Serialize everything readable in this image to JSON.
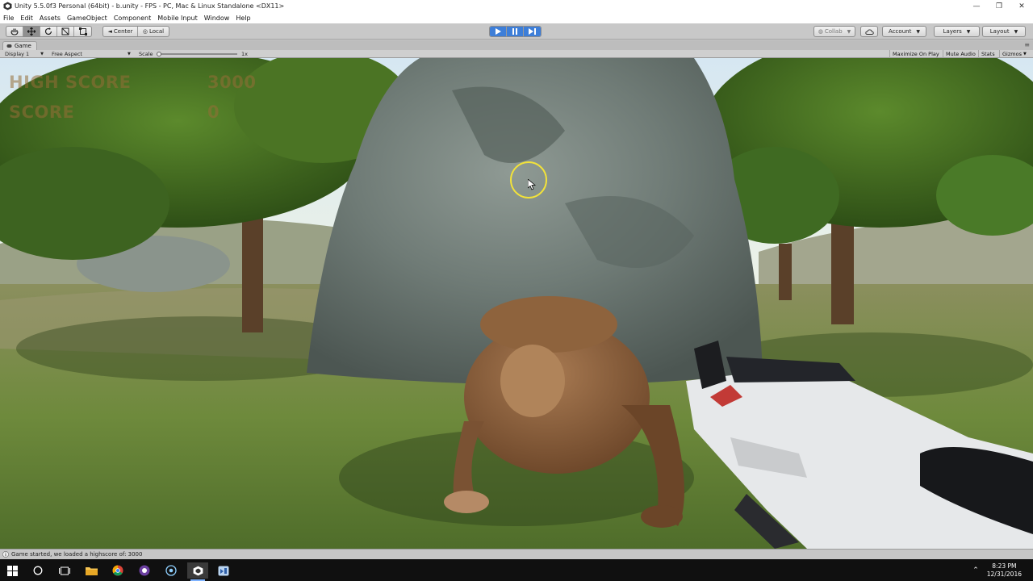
{
  "window": {
    "title": "Unity 5.5.0f3 Personal (64bit) - b.unity - FPS - PC, Mac & Linux Standalone <DX11>",
    "controls": [
      "—",
      "❐",
      "✕"
    ]
  },
  "menu": [
    "File",
    "Edit",
    "Assets",
    "GameObject",
    "Component",
    "Mobile Input",
    "Window",
    "Help"
  ],
  "toolbar": {
    "pivot_label": "Center",
    "space_label": "Local",
    "collab_label": "Collab",
    "account_label": "Account",
    "layers_label": "Layers",
    "layout_label": "Layout"
  },
  "game_panel": {
    "tab_label": "Game",
    "display": "Display 1",
    "aspect": "Free Aspect",
    "scale_label": "Scale",
    "scale_value": "1x",
    "maximize_on_play": "Maximize On Play",
    "mute_audio": "Mute Audio",
    "stats": "Stats",
    "gizmos": "Gizmos"
  },
  "hud": {
    "high_score_label": "HIGH SCORE",
    "high_score_value": "3000",
    "score_label": "SCORE",
    "score_value": "0"
  },
  "status": {
    "message": "Game started, we loaded a highscore of: 3000"
  },
  "taskbar": {
    "time": "8:23 PM",
    "date": "12/31/2016"
  },
  "colors": {
    "play_active": "#3d7ed8",
    "cursor_ring": "#f2e23a",
    "hud_text": "#966e37"
  }
}
